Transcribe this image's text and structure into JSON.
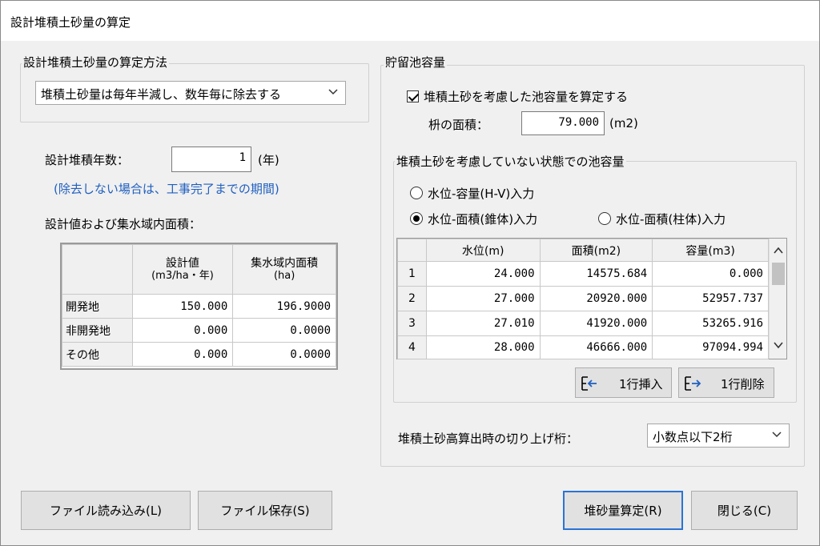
{
  "window": {
    "title": "設計堆積土砂量の算定"
  },
  "method_group": {
    "label": "設計堆積土砂量の算定方法",
    "selected": "堆積土砂量は毎年半減し、数年毎に除去する"
  },
  "design": {
    "years_label": "設計堆積年数：",
    "years_value": "1",
    "years_unit": "(年)",
    "note": "(除去しない場合は、工事完了までの期間)",
    "table_title": "設計値および集水域内面積：",
    "col1_header_l1": "設計値",
    "col1_header_l2": "(m3/ha・年)",
    "col2_header_l1": "集水域内面積",
    "col2_header_l2": "(ha)",
    "rows": [
      {
        "name": "開発地",
        "design": "150.000",
        "area": "196.9000"
      },
      {
        "name": "非開発地",
        "design": "0.000",
        "area": "0.0000"
      },
      {
        "name": "その他",
        "design": "0.000",
        "area": "0.0000"
      }
    ]
  },
  "pond": {
    "label": "貯留池容量",
    "consider_label": "堆積土砂を考慮した池容量を算定する",
    "consider_checked": true,
    "basin_label": "枡の面積：",
    "basin_value": "79.000",
    "basin_unit": "(m2)",
    "inner_group_label": "堆積土砂を考慮していない状態での池容量",
    "radio_hv": "水位-容量(H-V)入力",
    "radio_cone": "水位-面積(錐体)入力",
    "radio_column": "水位-面積(柱体)入力",
    "selected_radio": "cone",
    "grid_headers": [
      "水位(m)",
      "面積(m2)",
      "容量(m3)"
    ],
    "grid_rows": [
      {
        "no": "1",
        "level": "24.000",
        "area": "14575.684",
        "volume": "0.000"
      },
      {
        "no": "2",
        "level": "27.000",
        "area": "20920.000",
        "volume": "52957.737"
      },
      {
        "no": "3",
        "level": "27.010",
        "area": "41920.000",
        "volume": "53265.916"
      },
      {
        "no": "4",
        "level": "28.000",
        "area": "46666.000",
        "volume": "97094.994"
      }
    ],
    "insert_label": "1行挿入",
    "delete_label": "1行削除",
    "round_label": "堆積土砂高算出時の切り上げ桁：",
    "round_selected": "小数点以下2桁"
  },
  "footer": {
    "load_label": "ファイル読み込み(L)",
    "save_label": "ファイル保存(S)",
    "calc_label": "堆砂量算定(R)",
    "close_label": "閉じる(C)"
  },
  "icons": {
    "insert": "insert-row-icon",
    "delete": "delete-row-icon",
    "chevron": "chevron-down-icon"
  }
}
